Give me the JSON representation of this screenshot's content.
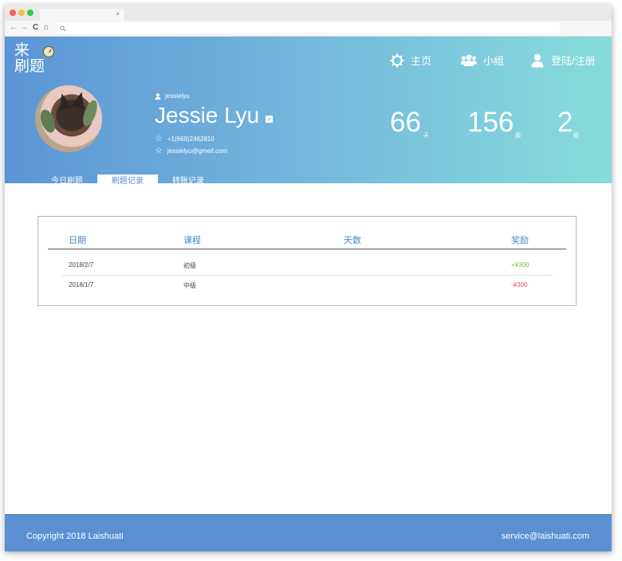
{
  "browser": {
    "tab_close": "×",
    "nav": {
      "back": "←",
      "forward": "→",
      "reload": "C",
      "home": "⌂"
    },
    "address_icon": "search-icon"
  },
  "logo": {
    "line1": "来",
    "line2": "刷题"
  },
  "topnav": {
    "home": "主页",
    "group": "小组",
    "login": "登陆/注册"
  },
  "profile": {
    "username": "jessielyu",
    "name": "Jessie Lyu",
    "phone": "+1(669)2462810",
    "email": "jessielyu@gmeil.com"
  },
  "stats": [
    {
      "value": "66",
      "unit": "天"
    },
    {
      "value": "156",
      "unit": "题"
    },
    {
      "value": "2",
      "unit": "组"
    }
  ],
  "tabs": [
    "今日刷题",
    "刷题记录",
    "转账记录"
  ],
  "active_tab": "刷题记录",
  "table": {
    "headers": {
      "date": "日期",
      "course": "课程",
      "days": "天数",
      "reward": "奖励"
    },
    "rows": [
      {
        "date": "2018/2/7",
        "course": "初级",
        "days": "",
        "reward": "+¥300"
      },
      {
        "date": "2018/1/7",
        "course": "中级",
        "days": "",
        "reward": "-¥300"
      }
    ]
  },
  "colors": {
    "accent": "#5b8fd2",
    "positive": "#7cc03a",
    "negative": "#e9506a"
  },
  "footer": {
    "copyright": "Copyright 2018 Laishuati",
    "email": "service@laishuati.com"
  }
}
